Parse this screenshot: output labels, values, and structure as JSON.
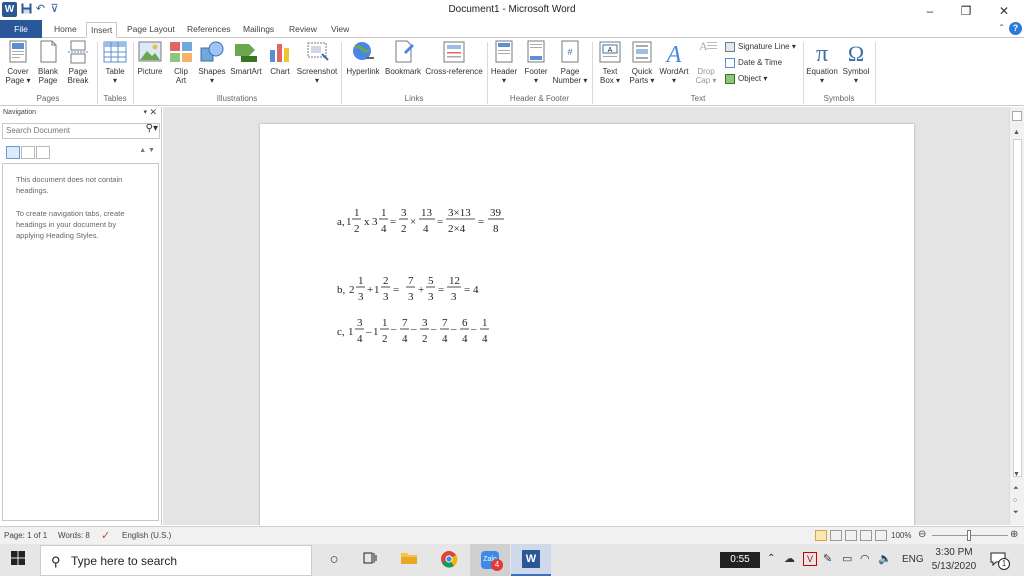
{
  "window": {
    "title": "Document1  -  Microsoft Word",
    "controls": [
      "–",
      "❐",
      "✕"
    ]
  },
  "tabs": [
    "File",
    "Home",
    "Insert",
    "Page Layout",
    "References",
    "Mailings",
    "Review",
    "View"
  ],
  "active_tab": "Insert",
  "ribbon": {
    "pages": {
      "cover_page": "Cover\nPage ▾",
      "blank_page": "Blank\nPage",
      "page_break": "Page\nBreak",
      "label": "Pages"
    },
    "tables": {
      "table": "Table\n▾",
      "label": "Tables"
    },
    "illustrations": {
      "picture": "Picture",
      "clip_art": "Clip\nArt",
      "shapes": "Shapes\n▾",
      "smartart": "SmartArt",
      "chart": "Chart",
      "screenshot": "Screenshot\n▾",
      "label": "Illustrations"
    },
    "links": {
      "hyperlink": "Hyperlink",
      "bookmark": "Bookmark",
      "cross_reference": "Cross-reference",
      "label": "Links"
    },
    "header_footer": {
      "header": "Header\n▾",
      "footer": "Footer\n▾",
      "page_number": "Page\nNumber ▾",
      "label": "Header & Footer"
    },
    "text": {
      "text_box": "Text\nBox ▾",
      "quick_parts": "Quick\nParts ▾",
      "wordart": "WordArt\n▾",
      "drop_cap": "Drop\nCap ▾",
      "signature_line": "Signature Line ▾",
      "date_time": "Date & Time",
      "object": "Object ▾",
      "label": "Text"
    },
    "symbols": {
      "equation": "Equation\n▾",
      "symbol": "Symbol\n▾",
      "label": "Symbols"
    }
  },
  "navigation": {
    "title": "Navigation",
    "search_placeholder": "Search Document",
    "msg1": "This document does not contain headings.",
    "msg2": "To create navigation tabs, create headings in your document by applying Heading Styles."
  },
  "document": {
    "a": {
      "label": "a,",
      "w1": "1",
      "n1": "1",
      "d1": "2",
      "x": "x",
      "w2": "3",
      "n2": "1",
      "d2": "4",
      "eq1": "=",
      "n3": "3",
      "d3": "2",
      "times1": "×",
      "n4": "13",
      "d4": "4",
      "eq2": "=",
      "n5": "3×13",
      "d5": "2×4",
      "eq3": "=",
      "n6": "39",
      "d6": "8"
    },
    "b": {
      "label": "b,",
      "w1": "2",
      "n1": "1",
      "d1": "3",
      "plus1": "+",
      "w2": "1",
      "n2": "2",
      "d2": "3",
      "eq1": "=",
      "n3": "7",
      "d3": "3",
      "plus2": "+",
      "n4": "5",
      "d4": "3",
      "eq2": "=",
      "n5": "12",
      "d5": "3",
      "eq3": "= 4"
    },
    "c": {
      "label": "c,",
      "w1": "1",
      "n1": "3",
      "d1": "4",
      "minus1": "–",
      "w2": "1",
      "n2": "1",
      "d2": "2",
      "minus2": "–",
      "n3": "7",
      "d3": "4",
      "minus3": "–",
      "n4": "3",
      "d4": "2",
      "minus4": "–",
      "n5": "7",
      "d5": "4",
      "minus5": "–",
      "n6": "6",
      "d6": "4",
      "minus6": "–",
      "n7": "1",
      "d7": "4"
    }
  },
  "status": {
    "page": "Page: 1 of 1",
    "words": "Words: 8",
    "language": "English (U.S.)",
    "zoom": "100%"
  },
  "taskbar": {
    "search_placeholder": "Type here to search",
    "timer": "0:55",
    "lang": "ENG",
    "time": "3:30 PM",
    "date": "5/13/2020",
    "notif_count": "1",
    "badge_count": "4"
  }
}
